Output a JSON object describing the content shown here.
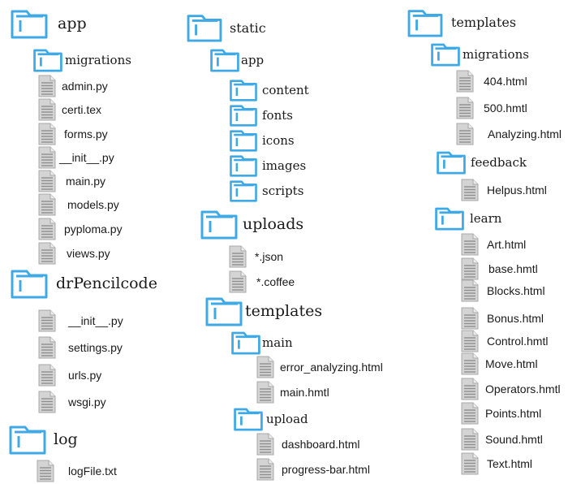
{
  "colors": {
    "folder_stroke": "#3fa9e6",
    "file_fill": "#d4d4d4",
    "file_line": "#8e8e8e"
  },
  "columns": {
    "left": {
      "app": {
        "label": "app",
        "icon": "folder-icon"
      },
      "migrations": {
        "label": "migrations",
        "icon": "folder-icon"
      },
      "app_files": [
        "admin.py",
        "certi.tex",
        "forms.py",
        "__init__.py",
        "main.py",
        "models.py",
        "pyploma.py",
        "views.py"
      ],
      "drpencilcode": {
        "label": "drPencilcode",
        "icon": "folder-icon"
      },
      "drpencilcode_files": [
        "__init__.py",
        "settings.py",
        "urls.py",
        "wsgi.py"
      ],
      "log": {
        "label": "log",
        "icon": "folder-icon"
      },
      "log_files": [
        "logFile.txt"
      ]
    },
    "middle": {
      "static": {
        "label": "static",
        "icon": "folder-icon"
      },
      "app": {
        "label": "app",
        "icon": "folder-icon"
      },
      "app_folders": [
        "content",
        "fonts",
        "icons",
        "images",
        "scripts"
      ],
      "uploads": {
        "label": "uploads",
        "icon": "folder-icon"
      },
      "uploads_files": [
        "*.json",
        "*.coffee"
      ],
      "templates": {
        "label": "templates",
        "icon": "folder-icon"
      },
      "main": {
        "label": "main",
        "icon": "folder-icon"
      },
      "main_files": [
        "error_analyzing.html",
        "main.hmtl"
      ],
      "upload": {
        "label": "upload",
        "icon": "folder-icon"
      },
      "upload_files": [
        "dashboard.html",
        "progress-bar.html"
      ]
    },
    "right": {
      "templates": {
        "label": "templates",
        "icon": "folder-icon"
      },
      "migrations": {
        "label": "migrations",
        "icon": "folder-icon"
      },
      "migrations_files": [
        "404.html",
        "500.hmtl",
        "Analyzing.html"
      ],
      "feedback": {
        "label": "feedback",
        "icon": "folder-icon"
      },
      "feedback_files": [
        "Helpus.html"
      ],
      "learn": {
        "label": "learn",
        "icon": "folder-icon"
      },
      "learn_files": [
        "Art.html",
        "base.hmtl",
        "Blocks.html",
        "Bonus.html",
        "Control.hmtl",
        "Move.html",
        "Operators.hmtl",
        "Points.html",
        "Sound.hmtl",
        "Text.html"
      ]
    }
  }
}
